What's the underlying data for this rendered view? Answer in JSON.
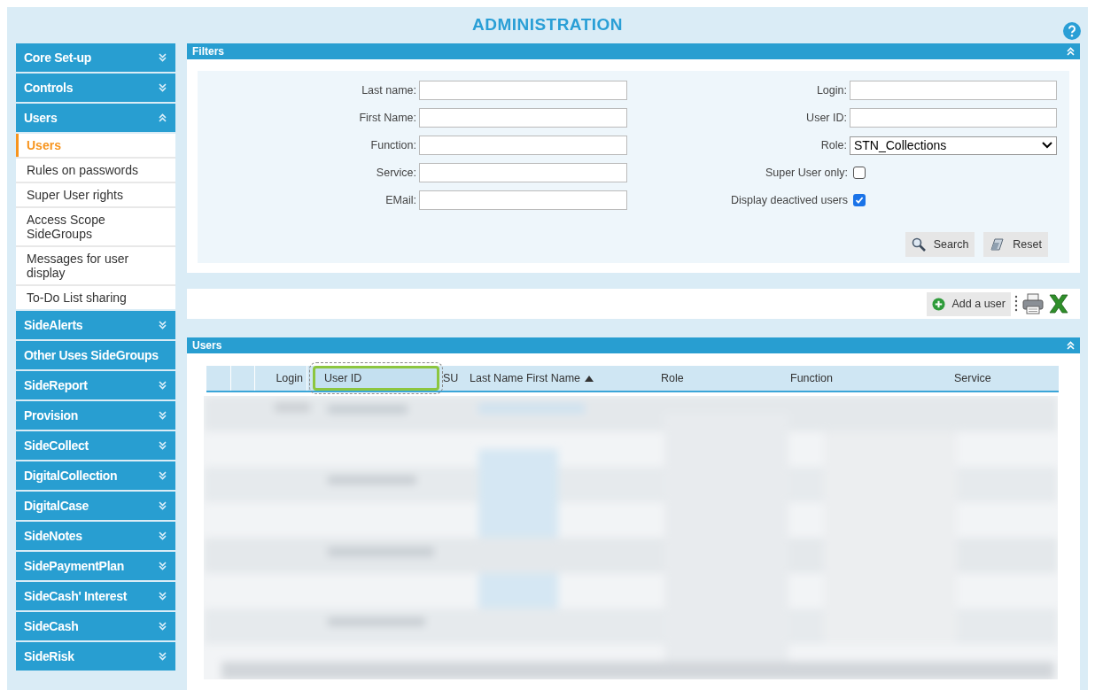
{
  "title": "ADMINISTRATION",
  "sidebar": [
    {
      "label": "Core Set-up",
      "expanded": false
    },
    {
      "label": "Controls",
      "expanded": false
    },
    {
      "label": "Users",
      "expanded": true,
      "children": [
        {
          "label": "Users",
          "selected": true
        },
        {
          "label": "Rules on passwords",
          "selected": false
        },
        {
          "label": "Super User rights",
          "selected": false
        },
        {
          "label": "Access Scope SideGroups",
          "selected": false
        },
        {
          "label": "Messages for user display",
          "selected": false
        },
        {
          "label": "To-Do List sharing",
          "selected": false
        }
      ]
    },
    {
      "label": "SideAlerts",
      "expanded": false
    },
    {
      "label": "Other Uses SideGroups"
    },
    {
      "label": "SideReport",
      "expanded": false
    },
    {
      "label": "Provision",
      "expanded": false
    },
    {
      "label": "SideCollect",
      "expanded": false
    },
    {
      "label": "DigitalCollection",
      "expanded": false
    },
    {
      "label": "DigitalCase",
      "expanded": false
    },
    {
      "label": "SideNotes",
      "expanded": false
    },
    {
      "label": "SidePaymentPlan",
      "expanded": false
    },
    {
      "label": "SideCash' Interest",
      "expanded": false
    },
    {
      "label": "SideCash",
      "expanded": false
    },
    {
      "label": "SideRisk",
      "expanded": false
    }
  ],
  "filters": {
    "title": "Filters",
    "expanded": true,
    "left_fields": [
      {
        "kind": "text",
        "label": "Last name:"
      },
      {
        "kind": "text",
        "label": "First Name:"
      },
      {
        "kind": "text",
        "label": "Function:"
      },
      {
        "kind": "text",
        "label": "Service:"
      },
      {
        "kind": "text",
        "label": "EMail:"
      }
    ],
    "right_fields": [
      {
        "kind": "text",
        "label": "Login:"
      },
      {
        "kind": "text",
        "label": "User ID:"
      },
      {
        "kind": "select",
        "label": "Role:",
        "value": "STN_Collections"
      },
      {
        "kind": "checkbox",
        "label": "Super User only:",
        "checked": false
      },
      {
        "kind": "checkbox",
        "label": "Display deactived users",
        "checked": true
      }
    ],
    "buttons": [
      {
        "kind": "search",
        "label": "Search"
      },
      {
        "kind": "reset",
        "label": "Reset"
      }
    ]
  },
  "toolbar": {
    "add_button": "Add a user"
  },
  "users": {
    "title": "Users",
    "expanded": true,
    "columns": [
      {
        "sorted": false,
        "highlighted": false
      },
      {
        "sorted": false,
        "highlighted": false
      },
      {
        "label": "Login",
        "sorted": false,
        "highlighted": false
      },
      {
        "label": "User ID",
        "sorted": false,
        "highlighted": true
      },
      {
        "label": "SU",
        "sorted": false,
        "highlighted": false
      },
      {
        "label": "Last Name First Name",
        "sorted": true,
        "highlighted": false
      },
      {
        "label": "Role",
        "sorted": false,
        "highlighted": false
      },
      {
        "label": "Function",
        "sorted": false,
        "highlighted": false
      },
      {
        "label": "Service",
        "sorted": false,
        "highlighted": false
      }
    ]
  }
}
